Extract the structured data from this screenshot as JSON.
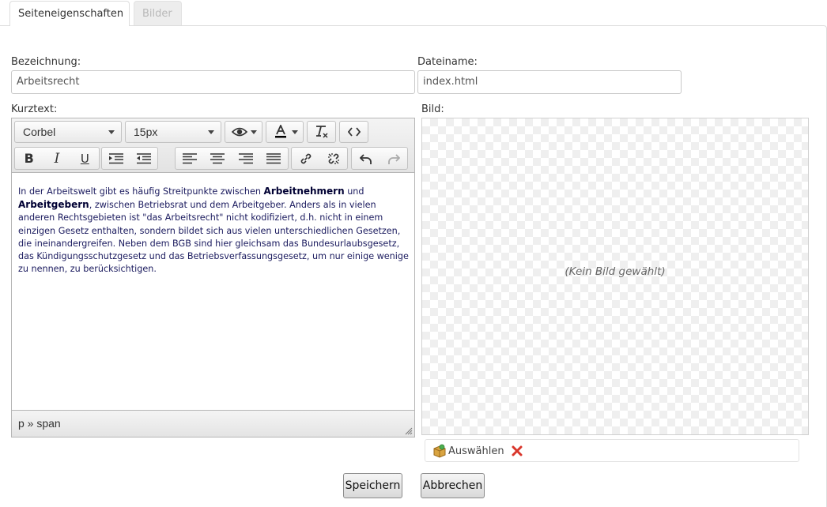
{
  "tabs": [
    {
      "label": "Seiteneigenschaften",
      "active": true
    },
    {
      "label": "Bilder",
      "active": false
    }
  ],
  "form": {
    "name_label": "Bezeichnung:",
    "name_value": "Arbeitsrecht",
    "filename_label": "Dateiname:",
    "filename_value": "index.html",
    "shorttext_label": "Kurztext:",
    "image_label": "Bild:"
  },
  "editor": {
    "font_family": "Corbel",
    "font_size": "15px",
    "content": {
      "p1": "In der Arbeitswelt gibt es häufig Streitpunkte zwischen ",
      "b1": "Arbeitnehmern",
      "p2": " und ",
      "b2": "Arbeitgebern",
      "p3": ", zwischen Betriebsrat und dem Arbeitgeber. Anders als in vielen anderen Rechtsgebieten ist \"das Arbeitsrecht\" nicht kodifiziert, d.h. nicht in einem einzigen Gesetz enthalten, sondern bildet sich aus vielen unterschiedlichen Gesetzen, die ineinandergreifen. Neben dem BGB sind hier gleichsam das Bundesurlaubsgesetz, das Kündigungsschutzgesetz und das Betriebsverfassungsgesetz, um nur einige wenige zu nennen, zu berücksichtigen."
    },
    "path": "p » span"
  },
  "image": {
    "placeholder": "(Kein Bild gewählt)",
    "choose_label": "Auswählen"
  },
  "buttons": {
    "save": "Speichern",
    "cancel": "Abbrechen"
  },
  "colors": {
    "text_color_indicator": "#000000",
    "remove_icon": "#d9362b"
  }
}
